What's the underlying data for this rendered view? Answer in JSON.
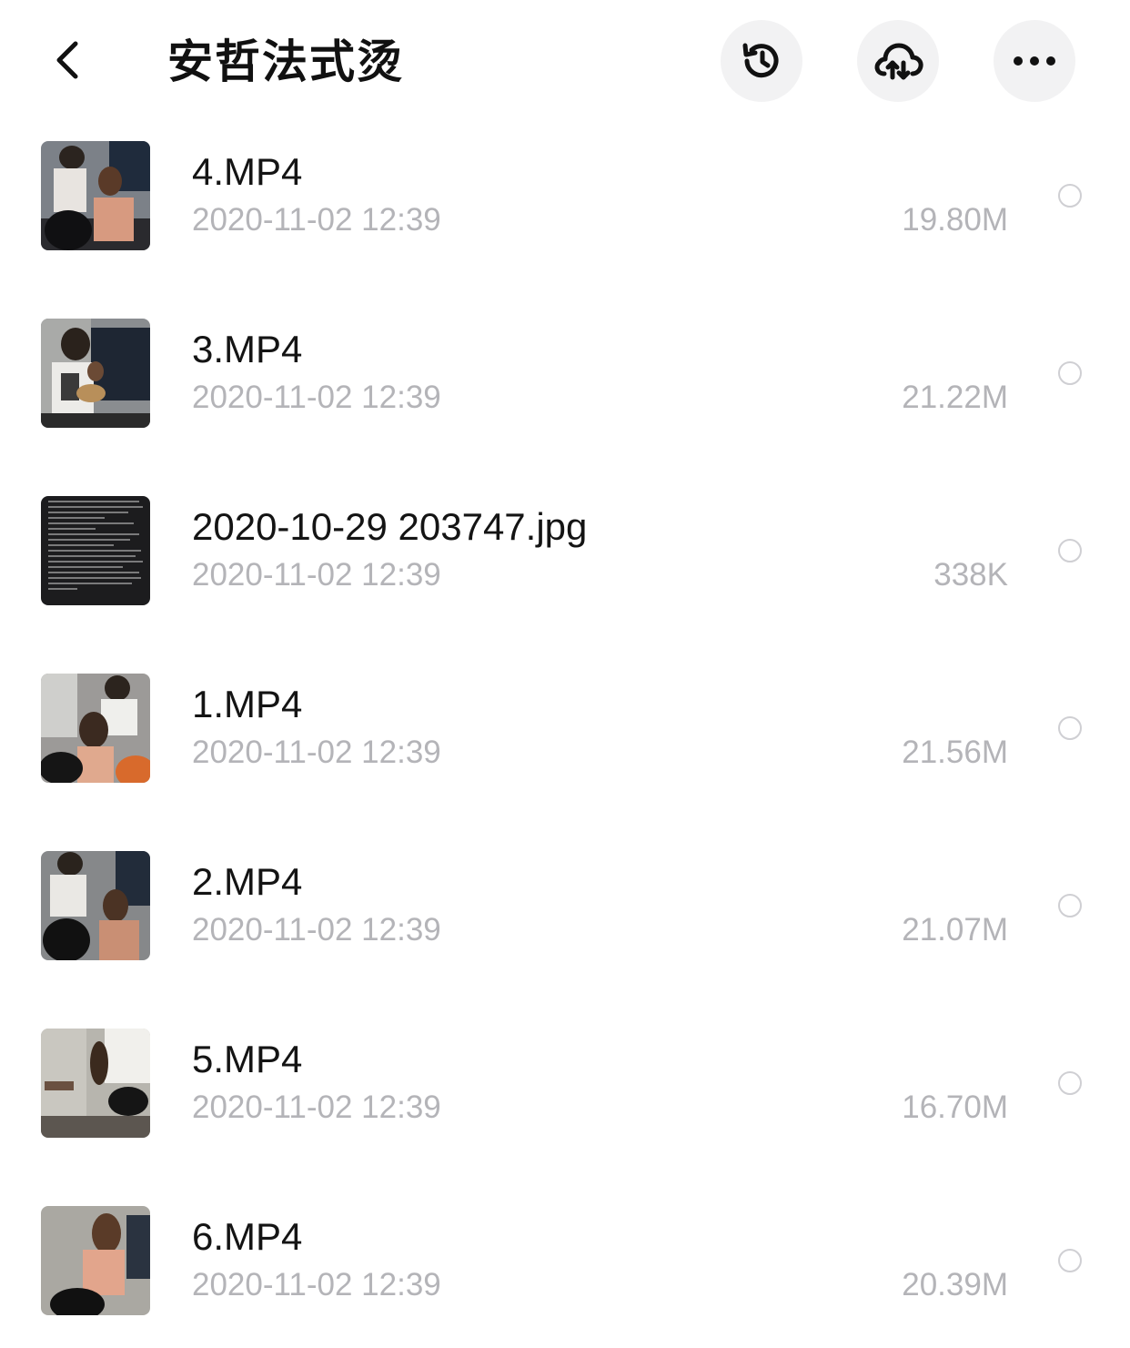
{
  "header": {
    "title": "安哲法式烫",
    "back_icon": "chevron-left-icon",
    "history_icon": "history-icon",
    "cloud_icon": "cloud-upload-icon",
    "more_icon": "more-horizontal-icon"
  },
  "files": [
    {
      "name": "4.MP4",
      "date": "2020-11-02 12:39",
      "size": "19.80M",
      "thumb": "video-thumbnail"
    },
    {
      "name": "3.MP4",
      "date": "2020-11-02 12:39",
      "size": "21.22M",
      "thumb": "video-thumbnail"
    },
    {
      "name": "2020-10-29 203747.jpg",
      "date": "2020-11-02 12:39",
      "size": "338K",
      "thumb": "image-thumbnail"
    },
    {
      "name": "1.MP4",
      "date": "2020-11-02 12:39",
      "size": "21.56M",
      "thumb": "video-thumbnail"
    },
    {
      "name": "2.MP4",
      "date": "2020-11-02 12:39",
      "size": "21.07M",
      "thumb": "video-thumbnail"
    },
    {
      "name": "5.MP4",
      "date": "2020-11-02 12:39",
      "size": "16.70M",
      "thumb": "video-thumbnail"
    },
    {
      "name": "6.MP4",
      "date": "2020-11-02 12:39",
      "size": "20.39M",
      "thumb": "video-thumbnail"
    }
  ],
  "colors": {
    "secondary_text": "#b4b4b8",
    "button_bg": "#f2f2f3",
    "primary_text": "#141414"
  }
}
